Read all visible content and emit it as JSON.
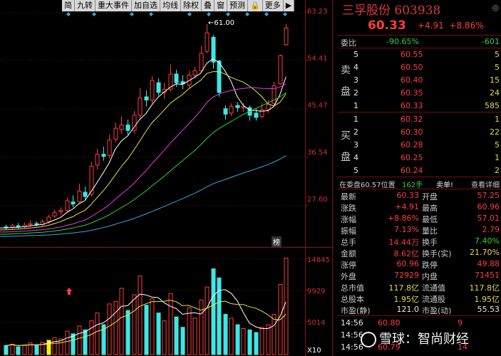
{
  "toolbar": [
    "简",
    "九转",
    "重大事件",
    "加自选",
    "均线",
    "除权",
    "叠",
    "窗",
    "预测",
    "🔒",
    "更多",
    "▶"
  ],
  "peak_label": "←61.00",
  "bang_label": "榜",
  "price_axis": [
    "63.23",
    "54.41",
    "45.47",
    "36.54",
    "27.60"
  ],
  "vol_axis": [
    "14845",
    "9929",
    "5014",
    "X10"
  ],
  "stock": {
    "name": "三孚股份",
    "code": "603938",
    "price": "60.33",
    "change": "+4.91",
    "change_pct": "+8.86%"
  },
  "weibi": {
    "label": "委比",
    "pct": "-90.65%",
    "val": "-601"
  },
  "asks": [
    {
      "lvl": "5",
      "price": "60.55",
      "vol": "5"
    },
    {
      "lvl": "4",
      "price": "60.50",
      "vol": "5"
    },
    {
      "lvl": "3",
      "price": "60.40",
      "vol": "15"
    },
    {
      "lvl": "2",
      "price": "60.35",
      "vol": "24"
    },
    {
      "lvl": "1",
      "price": "60.33",
      "vol": "585"
    }
  ],
  "bids": [
    {
      "lvl": "1",
      "price": "60.32",
      "vol": "1"
    },
    {
      "lvl": "2",
      "price": "60.30",
      "vol": "22"
    },
    {
      "lvl": "3",
      "price": "60.28",
      "vol": "5"
    },
    {
      "lvl": "4",
      "price": "60.25",
      "vol": "1"
    },
    {
      "lvl": "5",
      "price": "60.24",
      "vol": "2"
    }
  ],
  "sell_side_label": [
    "卖",
    "盘"
  ],
  "buy_side_label": [
    "买",
    "盘"
  ],
  "order_line": {
    "text": "在委盘60.57位置",
    "qty": "162手",
    "action": "卖单!",
    "detail": "查看详细"
  },
  "quotes": [
    {
      "l": "最新",
      "v": "60.33",
      "l2": "开盘",
      "v2": "57.25"
    },
    {
      "l": "涨跌",
      "v": "+4.91",
      "l2": "最高",
      "v2": "60.96"
    },
    {
      "l": "涨幅",
      "v": "+8.86%",
      "l2": "最低",
      "v2": "57.01"
    },
    {
      "l": "振幅",
      "v": "7.13%",
      "l2": "量比",
      "v2": "2.79"
    },
    {
      "l": "总手",
      "v": "14.44万",
      "l2": "换手",
      "v2": "7.40%"
    },
    {
      "l": "金额",
      "v": "8.62亿",
      "l2": "换手(实)",
      "v2": "21.70%"
    },
    {
      "l": "涨停",
      "v": "60.96",
      "l2": "跌停",
      "v2": "49.88"
    },
    {
      "l": "外盘",
      "v": "72929",
      "l2": "内盘",
      "v2": "71451"
    },
    {
      "l": "总市值",
      "v": "117.8亿",
      "l2": "流通值",
      "v2": "117.8亿"
    },
    {
      "l": "总股本",
      "v": "1.95亿",
      "l2": "流通股",
      "v2": "1.95亿"
    },
    {
      "l": "市盈(静)",
      "v": "121.0",
      "l2": "市盈(动)",
      "v2": "55.53"
    }
  ],
  "ticks": [
    {
      "t": "14:56",
      "p": "60.80",
      "v": "9"
    },
    {
      "t": "14:56",
      "p": "",
      "v": ""
    },
    {
      "t": "14:56",
      "p": "60.79",
      "v": "14"
    }
  ],
  "watermark": "雪球：智尚财经",
  "colors": {
    "up": "#ff3c3c",
    "down": "#3de7e7",
    "ma5": "#ffffff",
    "ma10": "#e8e34a",
    "ma20": "#e53fe5",
    "ma30": "#2fd33a",
    "ma60": "#33a6e6"
  }
}
